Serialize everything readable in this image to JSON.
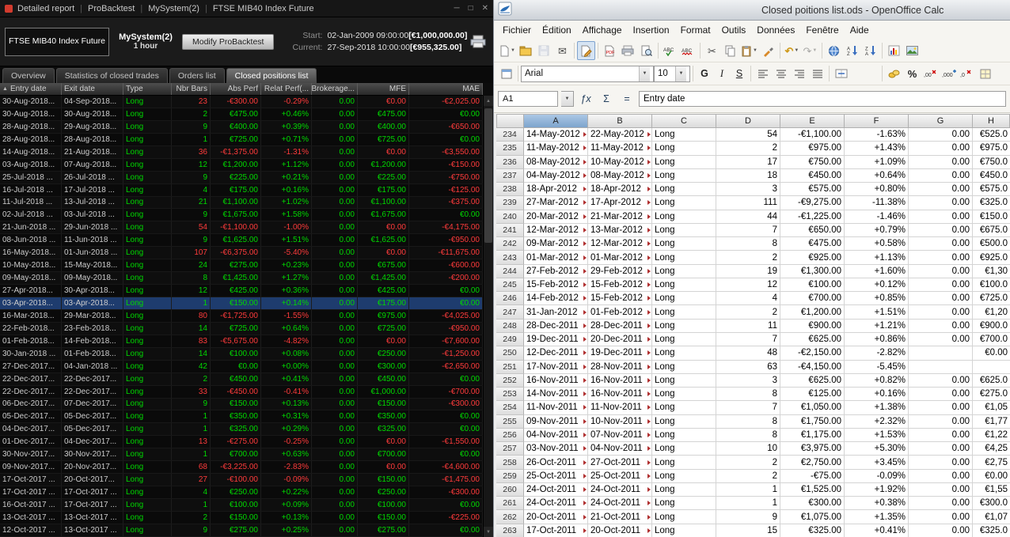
{
  "icons": {
    "sort_arrow": "▲",
    "minimize": "─",
    "maximize": "□",
    "close": "✕",
    "dropdown": "▼"
  },
  "left_app": {
    "titlebar": {
      "app_tabs": [
        "Detailed report",
        "ProBacktest",
        "MySystem(2)",
        "FTSE MIB40 Index Future"
      ],
      "window_controls": [
        "─",
        "□",
        "✕"
      ]
    },
    "header": {
      "instrument_button": "FTSE MIB40 Index Future",
      "system_name": "MySystem(2)",
      "timeframe": "1 hour",
      "modify_button": "Modify ProBacktest",
      "start_label": "Start:",
      "start_value": "02-Jan-2009 09:00:00",
      "start_amount": "[€1,000,000.00]",
      "current_label": "Current:",
      "current_value": "27-Sep-2018 10:00:00",
      "current_amount": "[€955,325.00]"
    },
    "tabs": [
      "Overview",
      "Statistics of closed trades",
      "Orders list",
      "Closed positions list"
    ],
    "active_tab": "Closed positions list",
    "table": {
      "columns": [
        "Entry date",
        "Exit date",
        "Type",
        "Nbr Bars",
        "Abs Perf",
        "Relat Perf(...",
        "Brokerage...",
        "MFE",
        "MAE"
      ],
      "rows": [
        {
          "entry": "30-Aug-2018...",
          "exit": "04-Sep-2018...",
          "type": "Long",
          "bars": "23",
          "abs": "-€300.00",
          "rel": "-0.29%",
          "brok": "0.00",
          "mfe": "€0.00",
          "mae": "-€2,025.00"
        },
        {
          "entry": "30-Aug-2018...",
          "exit": "30-Aug-2018...",
          "type": "Long",
          "bars": "2",
          "abs": "€475.00",
          "rel": "+0.46%",
          "brok": "0.00",
          "mfe": "€475.00",
          "mae": "€0.00"
        },
        {
          "entry": "28-Aug-2018...",
          "exit": "29-Aug-2018...",
          "type": "Long",
          "bars": "9",
          "abs": "€400.00",
          "rel": "+0.39%",
          "brok": "0.00",
          "mfe": "€400.00",
          "mae": "-€650.00"
        },
        {
          "entry": "28-Aug-2018...",
          "exit": "28-Aug-2018...",
          "type": "Long",
          "bars": "1",
          "abs": "€725.00",
          "rel": "+0.71%",
          "brok": "0.00",
          "mfe": "€725.00",
          "mae": "€0.00"
        },
        {
          "entry": "14-Aug-2018...",
          "exit": "21-Aug-2018...",
          "type": "Long",
          "bars": "36",
          "abs": "-€1,375.00",
          "rel": "-1.31%",
          "brok": "0.00",
          "mfe": "€0.00",
          "mae": "-€3,550.00"
        },
        {
          "entry": "03-Aug-2018...",
          "exit": "07-Aug-2018...",
          "type": "Long",
          "bars": "12",
          "abs": "€1,200.00",
          "rel": "+1.12%",
          "brok": "0.00",
          "mfe": "€1,200.00",
          "mae": "-€150.00"
        },
        {
          "entry": "25-Jul-2018 ...",
          "exit": "26-Jul-2018 ...",
          "type": "Long",
          "bars": "9",
          "abs": "€225.00",
          "rel": "+0.21%",
          "brok": "0.00",
          "mfe": "€225.00",
          "mae": "-€750.00"
        },
        {
          "entry": "16-Jul-2018 ...",
          "exit": "17-Jul-2018 ...",
          "type": "Long",
          "bars": "4",
          "abs": "€175.00",
          "rel": "+0.16%",
          "brok": "0.00",
          "mfe": "€175.00",
          "mae": "-€125.00"
        },
        {
          "entry": "11-Jul-2018 ...",
          "exit": "13-Jul-2018 ...",
          "type": "Long",
          "bars": "21",
          "abs": "€1,100.00",
          "rel": "+1.02%",
          "brok": "0.00",
          "mfe": "€1,100.00",
          "mae": "-€375.00"
        },
        {
          "entry": "02-Jul-2018 ...",
          "exit": "03-Jul-2018 ...",
          "type": "Long",
          "bars": "9",
          "abs": "€1,675.00",
          "rel": "+1.58%",
          "brok": "0.00",
          "mfe": "€1,675.00",
          "mae": "€0.00"
        },
        {
          "entry": "21-Jun-2018 ...",
          "exit": "29-Jun-2018 ...",
          "type": "Long",
          "bars": "54",
          "abs": "-€1,100.00",
          "rel": "-1.00%",
          "brok": "0.00",
          "mfe": "€0.00",
          "mae": "-€4,175.00"
        },
        {
          "entry": "08-Jun-2018 ...",
          "exit": "11-Jun-2018 ...",
          "type": "Long",
          "bars": "9",
          "abs": "€1,625.00",
          "rel": "+1.51%",
          "brok": "0.00",
          "mfe": "€1,625.00",
          "mae": "-€950.00"
        },
        {
          "entry": "16-May-2018...",
          "exit": "01-Jun-2018 ...",
          "type": "Long",
          "bars": "107",
          "abs": "-€6,375.00",
          "rel": "-5.40%",
          "brok": "0.00",
          "mfe": "€0.00",
          "mae": "-€11,675.00"
        },
        {
          "entry": "10-May-2018...",
          "exit": "15-May-2018...",
          "type": "Long",
          "bars": "24",
          "abs": "€275.00",
          "rel": "+0.23%",
          "brok": "0.00",
          "mfe": "€675.00",
          "mae": "-€600.00"
        },
        {
          "entry": "09-May-2018...",
          "exit": "09-May-2018...",
          "type": "Long",
          "bars": "8",
          "abs": "€1,425.00",
          "rel": "+1.27%",
          "brok": "0.00",
          "mfe": "€1,425.00",
          "mae": "-€200.00"
        },
        {
          "entry": "27-Apr-2018...",
          "exit": "30-Apr-2018...",
          "type": "Long",
          "bars": "12",
          "abs": "€425.00",
          "rel": "+0.36%",
          "brok": "0.00",
          "mfe": "€425.00",
          "mae": "€0.00"
        },
        {
          "entry": "03-Apr-2018...",
          "exit": "03-Apr-2018...",
          "type": "Long",
          "bars": "1",
          "abs": "€150.00",
          "rel": "+0.14%",
          "brok": "0.00",
          "mfe": "€175.00",
          "mae": "€0.00",
          "selected": true
        },
        {
          "entry": "16-Mar-2018...",
          "exit": "29-Mar-2018...",
          "type": "Long",
          "bars": "80",
          "abs": "-€1,725.00",
          "rel": "-1.55%",
          "brok": "0.00",
          "mfe": "€975.00",
          "mae": "-€4,025.00"
        },
        {
          "entry": "22-Feb-2018...",
          "exit": "23-Feb-2018...",
          "type": "Long",
          "bars": "14",
          "abs": "€725.00",
          "rel": "+0.64%",
          "brok": "0.00",
          "mfe": "€725.00",
          "mae": "-€950.00"
        },
        {
          "entry": "01-Feb-2018...",
          "exit": "14-Feb-2018...",
          "type": "Long",
          "bars": "83",
          "abs": "-€5,675.00",
          "rel": "-4.82%",
          "brok": "0.00",
          "mfe": "€0.00",
          "mae": "-€7,600.00"
        },
        {
          "entry": "30-Jan-2018 ...",
          "exit": "01-Feb-2018...",
          "type": "Long",
          "bars": "14",
          "abs": "€100.00",
          "rel": "+0.08%",
          "brok": "0.00",
          "mfe": "€250.00",
          "mae": "-€1,250.00"
        },
        {
          "entry": "27-Dec-2017...",
          "exit": "04-Jan-2018 ...",
          "type": "Long",
          "bars": "42",
          "abs": "€0.00",
          "rel": "+0.00%",
          "brok": "0.00",
          "mfe": "€300.00",
          "mae": "-€2,650.00"
        },
        {
          "entry": "22-Dec-2017...",
          "exit": "22-Dec-2017...",
          "type": "Long",
          "bars": "2",
          "abs": "€450.00",
          "rel": "+0.41%",
          "brok": "0.00",
          "mfe": "€450.00",
          "mae": "€0.00"
        },
        {
          "entry": "22-Dec-2017...",
          "exit": "22-Dec-2017...",
          "type": "Long",
          "bars": "33",
          "abs": "-€450.00",
          "rel": "-0.41%",
          "brok": "0.00",
          "mfe": "€1,000.00",
          "mae": "-€700.00"
        },
        {
          "entry": "06-Dec-2017...",
          "exit": "07-Dec-2017...",
          "type": "Long",
          "bars": "9",
          "abs": "€150.00",
          "rel": "+0.13%",
          "brok": "0.00",
          "mfe": "€150.00",
          "mae": "-€300.00"
        },
        {
          "entry": "05-Dec-2017...",
          "exit": "05-Dec-2017...",
          "type": "Long",
          "bars": "1",
          "abs": "€350.00",
          "rel": "+0.31%",
          "brok": "0.00",
          "mfe": "€350.00",
          "mae": "€0.00"
        },
        {
          "entry": "04-Dec-2017...",
          "exit": "05-Dec-2017...",
          "type": "Long",
          "bars": "1",
          "abs": "€325.00",
          "rel": "+0.29%",
          "brok": "0.00",
          "mfe": "€325.00",
          "mae": "€0.00"
        },
        {
          "entry": "01-Dec-2017...",
          "exit": "04-Dec-2017...",
          "type": "Long",
          "bars": "13",
          "abs": "-€275.00",
          "rel": "-0.25%",
          "brok": "0.00",
          "mfe": "€0.00",
          "mae": "-€1,550.00"
        },
        {
          "entry": "30-Nov-2017...",
          "exit": "30-Nov-2017...",
          "type": "Long",
          "bars": "1",
          "abs": "€700.00",
          "rel": "+0.63%",
          "brok": "0.00",
          "mfe": "€700.00",
          "mae": "€0.00"
        },
        {
          "entry": "09-Nov-2017...",
          "exit": "20-Nov-2017...",
          "type": "Long",
          "bars": "68",
          "abs": "-€3,225.00",
          "rel": "-2.83%",
          "brok": "0.00",
          "mfe": "€0.00",
          "mae": "-€4,600.00"
        },
        {
          "entry": "17-Oct-2017 ...",
          "exit": "20-Oct-2017...",
          "type": "Long",
          "bars": "27",
          "abs": "-€100.00",
          "rel": "-0.09%",
          "brok": "0.00",
          "mfe": "€150.00",
          "mae": "-€1,475.00"
        },
        {
          "entry": "17-Oct-2017 ...",
          "exit": "17-Oct-2017 ...",
          "type": "Long",
          "bars": "4",
          "abs": "€250.00",
          "rel": "+0.22%",
          "brok": "0.00",
          "mfe": "€250.00",
          "mae": "-€300.00"
        },
        {
          "entry": "16-Oct-2017 ...",
          "exit": "17-Oct-2017 ...",
          "type": "Long",
          "bars": "1",
          "abs": "€100.00",
          "rel": "+0.09%",
          "brok": "0.00",
          "mfe": "€100.00",
          "mae": "€0.00"
        },
        {
          "entry": "13-Oct-2017 ...",
          "exit": "13-Oct-2017 ...",
          "type": "Long",
          "bars": "2",
          "abs": "€150.00",
          "rel": "+0.13%",
          "brok": "0.00",
          "mfe": "€150.00",
          "mae": "-€225.00"
        },
        {
          "entry": "12-Oct-2017 ...",
          "exit": "13-Oct-2017 ...",
          "type": "Long",
          "bars": "9",
          "abs": "€275.00",
          "rel": "+0.25%",
          "brok": "0.00",
          "mfe": "€275.00",
          "mae": "€0.00"
        }
      ]
    }
  },
  "calc": {
    "title": "Closed poitions list.ods - OpenOffice Calc",
    "menus": [
      "Fichier",
      "Édition",
      "Affichage",
      "Insertion",
      "Format",
      "Outils",
      "Données",
      "Fenêtre",
      "Aide"
    ],
    "toolbar": {
      "font_name": "Arial",
      "font_size": "10",
      "bold_label": "G",
      "italic_label": "I",
      "underline_label": "S",
      "percent_label": "%"
    },
    "formula_bar": {
      "cell_reference": "A1",
      "function_label": "ƒx",
      "sum_label": "Σ",
      "formula_label": "=",
      "content": "Entry date"
    },
    "selected_column": "A",
    "columns": [
      "A",
      "B",
      "C",
      "D",
      "E",
      "F",
      "G",
      "H"
    ],
    "rows": [
      {
        "n": 234,
        "a": "14-May-2012",
        "b": "22-May-2012",
        "c": "Long",
        "d": "54",
        "e": "-€1,100.00",
        "f": "-1.63%",
        "g": "0.00",
        "h": "€525.0"
      },
      {
        "n": 235,
        "a": "11-May-2012",
        "b": "11-May-2012",
        "c": "Long",
        "d": "2",
        "e": "€975.00",
        "f": "+1.43%",
        "g": "0.00",
        "h": "€975.0"
      },
      {
        "n": 236,
        "a": "08-May-2012",
        "b": "10-May-2012",
        "c": "Long",
        "d": "17",
        "e": "€750.00",
        "f": "+1.09%",
        "g": "0.00",
        "h": "€750.0"
      },
      {
        "n": 237,
        "a": "04-May-2012",
        "b": "08-May-2012",
        "c": "Long",
        "d": "18",
        "e": "€450.00",
        "f": "+0.64%",
        "g": "0.00",
        "h": "€450.0"
      },
      {
        "n": 238,
        "a": "18-Apr-2012",
        "b": "18-Apr-2012",
        "c": "Long",
        "d": "3",
        "e": "€575.00",
        "f": "+0.80%",
        "g": "0.00",
        "h": "€575.0"
      },
      {
        "n": 239,
        "a": "27-Mar-2012",
        "b": "17-Apr-2012",
        "c": "Long",
        "d": "111",
        "e": "-€9,275.00",
        "f": "-11.38%",
        "g": "0.00",
        "h": "€325.0"
      },
      {
        "n": 240,
        "a": "20-Mar-2012",
        "b": "21-Mar-2012",
        "c": "Long",
        "d": "44",
        "e": "-€1,225.00",
        "f": "-1.46%",
        "g": "0.00",
        "h": "€150.0"
      },
      {
        "n": 241,
        "a": "12-Mar-2012",
        "b": "13-Mar-2012",
        "c": "Long",
        "d": "7",
        "e": "€650.00",
        "f": "+0.79%",
        "g": "0.00",
        "h": "€675.0"
      },
      {
        "n": 242,
        "a": "09-Mar-2012",
        "b": "12-Mar-2012",
        "c": "Long",
        "d": "8",
        "e": "€475.00",
        "f": "+0.58%",
        "g": "0.00",
        "h": "€500.0"
      },
      {
        "n": 243,
        "a": "01-Mar-2012",
        "b": "01-Mar-2012",
        "c": "Long",
        "d": "2",
        "e": "€925.00",
        "f": "+1.13%",
        "g": "0.00",
        "h": "€925.0"
      },
      {
        "n": 244,
        "a": "27-Feb-2012",
        "b": "29-Feb-2012",
        "c": "Long",
        "d": "19",
        "e": "€1,300.00",
        "f": "+1.60%",
        "g": "0.00",
        "h": "€1,30"
      },
      {
        "n": 245,
        "a": "15-Feb-2012",
        "b": "15-Feb-2012",
        "c": "Long",
        "d": "12",
        "e": "€100.00",
        "f": "+0.12%",
        "g": "0.00",
        "h": "€100.0"
      },
      {
        "n": 246,
        "a": "14-Feb-2012",
        "b": "15-Feb-2012",
        "c": "Long",
        "d": "4",
        "e": "€700.00",
        "f": "+0.85%",
        "g": "0.00",
        "h": "€725.0"
      },
      {
        "n": 247,
        "a": "31-Jan-2012",
        "b": "01-Feb-2012",
        "c": "Long",
        "d": "2",
        "e": "€1,200.00",
        "f": "+1.51%",
        "g": "0.00",
        "h": "€1,20"
      },
      {
        "n": 248,
        "a": "28-Dec-2011",
        "b": "28-Dec-2011",
        "c": "Long",
        "d": "11",
        "e": "€900.00",
        "f": "+1.21%",
        "g": "0.00",
        "h": "€900.0"
      },
      {
        "n": 249,
        "a": "19-Dec-2011",
        "b": "20-Dec-2011",
        "c": "Long",
        "d": "7",
        "e": "€625.00",
        "f": "+0.86%",
        "g": "0.00",
        "h": "€700.0"
      },
      {
        "n": 250,
        "a": "12-Dec-2011",
        "b": "19-Dec-2011",
        "c": "Long",
        "d": "48",
        "e": "-€2,150.00",
        "f": "-2.82%",
        "g": "",
        "h": "€0.00"
      },
      {
        "n": 251,
        "a": "17-Nov-2011",
        "b": "28-Nov-2011",
        "c": "Long",
        "d": "63",
        "e": "-€4,150.00",
        "f": "-5.45%",
        "g": "",
        "h": ""
      },
      {
        "n": 252,
        "a": "16-Nov-2011",
        "b": "16-Nov-2011",
        "c": "Long",
        "d": "3",
        "e": "€625.00",
        "f": "+0.82%",
        "g": "0.00",
        "h": "€625.0"
      },
      {
        "n": 253,
        "a": "14-Nov-2011",
        "b": "16-Nov-2011",
        "c": "Long",
        "d": "8",
        "e": "€125.00",
        "f": "+0.16%",
        "g": "0.00",
        "h": "€275.0"
      },
      {
        "n": 254,
        "a": "11-Nov-2011",
        "b": "11-Nov-2011",
        "c": "Long",
        "d": "7",
        "e": "€1,050.00",
        "f": "+1.38%",
        "g": "0.00",
        "h": "€1,05"
      },
      {
        "n": 255,
        "a": "09-Nov-2011",
        "b": "10-Nov-2011",
        "c": "Long",
        "d": "8",
        "e": "€1,750.00",
        "f": "+2.32%",
        "g": "0.00",
        "h": "€1,77"
      },
      {
        "n": 256,
        "a": "04-Nov-2011",
        "b": "07-Nov-2011",
        "c": "Long",
        "d": "8",
        "e": "€1,175.00",
        "f": "+1.53%",
        "g": "0.00",
        "h": "€1,22"
      },
      {
        "n": 257,
        "a": "03-Nov-2011",
        "b": "04-Nov-2011",
        "c": "Long",
        "d": "10",
        "e": "€3,975.00",
        "f": "+5.30%",
        "g": "0.00",
        "h": "€4,25"
      },
      {
        "n": 258,
        "a": "26-Oct-2011",
        "b": "27-Oct-2011",
        "c": "Long",
        "d": "2",
        "e": "€2,750.00",
        "f": "+3.45%",
        "g": "0.00",
        "h": "€2,75"
      },
      {
        "n": 259,
        "a": "25-Oct-2011",
        "b": "25-Oct-2011",
        "c": "Long",
        "d": "2",
        "e": "-€75.00",
        "f": "-0.09%",
        "g": "0.00",
        "h": "€0.00"
      },
      {
        "n": 260,
        "a": "24-Oct-2011",
        "b": "24-Oct-2011",
        "c": "Long",
        "d": "1",
        "e": "€1,525.00",
        "f": "+1.92%",
        "g": "0.00",
        "h": "€1,55"
      },
      {
        "n": 261,
        "a": "24-Oct-2011",
        "b": "24-Oct-2011",
        "c": "Long",
        "d": "1",
        "e": "€300.00",
        "f": "+0.38%",
        "g": "0.00",
        "h": "€300.0"
      },
      {
        "n": 262,
        "a": "20-Oct-2011",
        "b": "21-Oct-2011",
        "c": "Long",
        "d": "9",
        "e": "€1,075.00",
        "f": "+1.35%",
        "g": "0.00",
        "h": "€1,07"
      },
      {
        "n": 263,
        "a": "17-Oct-2011",
        "b": "20-Oct-2011",
        "c": "Long",
        "d": "15",
        "e": "€325.00",
        "f": "+0.41%",
        "g": "0.00",
        "h": "€325.0"
      }
    ]
  }
}
